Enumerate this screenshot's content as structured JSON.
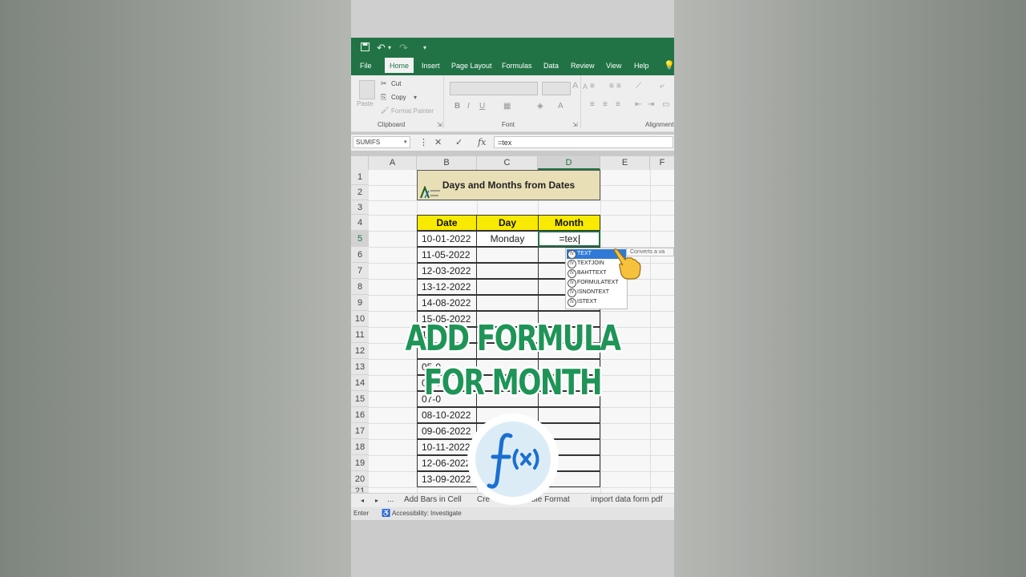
{
  "ribbon": {
    "tabs": [
      "File",
      "Home",
      "Insert",
      "Page Layout",
      "Formulas",
      "Data",
      "Review",
      "View",
      "Help"
    ],
    "active_tab": "Home",
    "clipboard": {
      "paste": "Paste",
      "cut": "Cut",
      "copy": "Copy",
      "format_painter": "Format Painter",
      "group": "Clipboard"
    },
    "font_group": "Font",
    "alignment_group": "Alignment"
  },
  "formula_bar": {
    "name_box": "SUMIFS",
    "formula": "=tex"
  },
  "grid": {
    "columns": [
      "A",
      "B",
      "C",
      "D",
      "E",
      "F"
    ],
    "rows": [
      "1",
      "2",
      "3",
      "4",
      "5",
      "6",
      "7",
      "8",
      "9",
      "10",
      "11",
      "12",
      "13",
      "14",
      "15",
      "16",
      "17",
      "18",
      "19",
      "20",
      "21"
    ],
    "title": "Days and Months from Dates",
    "headers": {
      "date": "Date",
      "day": "Day",
      "month": "Month"
    },
    "dates": [
      "10-01-2022",
      "11-05-2022",
      "12-03-2022",
      "13-12-2022",
      "14-08-2022",
      "15-05-2022",
      "1",
      "",
      "05-0",
      "06-0",
      "07-0",
      "08-10-2022",
      "09-06-2022",
      "10-11-2022",
      "12-06-2022",
      "13-09-2022"
    ],
    "first_day": "Monday",
    "active_cell_value": "=tex"
  },
  "autocomplete": {
    "items": [
      "TEXT",
      "TEXTJOIN",
      "BAHTTEXT",
      "FORMULATEXT",
      "ISNONTEXT",
      "ISTEXT"
    ],
    "tooltip": "Converts a va"
  },
  "sheet_tabs": [
    "...",
    "Add Bars in Cell",
    "Cre",
    "ble Format",
    "import data form pdf"
  ],
  "status": {
    "mode": "Enter",
    "accessibility": "Accessibility: Investigate"
  },
  "overlay": {
    "line1": "ADD FORMULA",
    "line2": "FOR MONTH"
  },
  "colors": {
    "excel_green": "#217346",
    "header_yellow": "#f8ea00",
    "title_fill": "#e8dfb6",
    "overlay_green": "#1f9457",
    "fx_blue": "#1b6fd0"
  }
}
